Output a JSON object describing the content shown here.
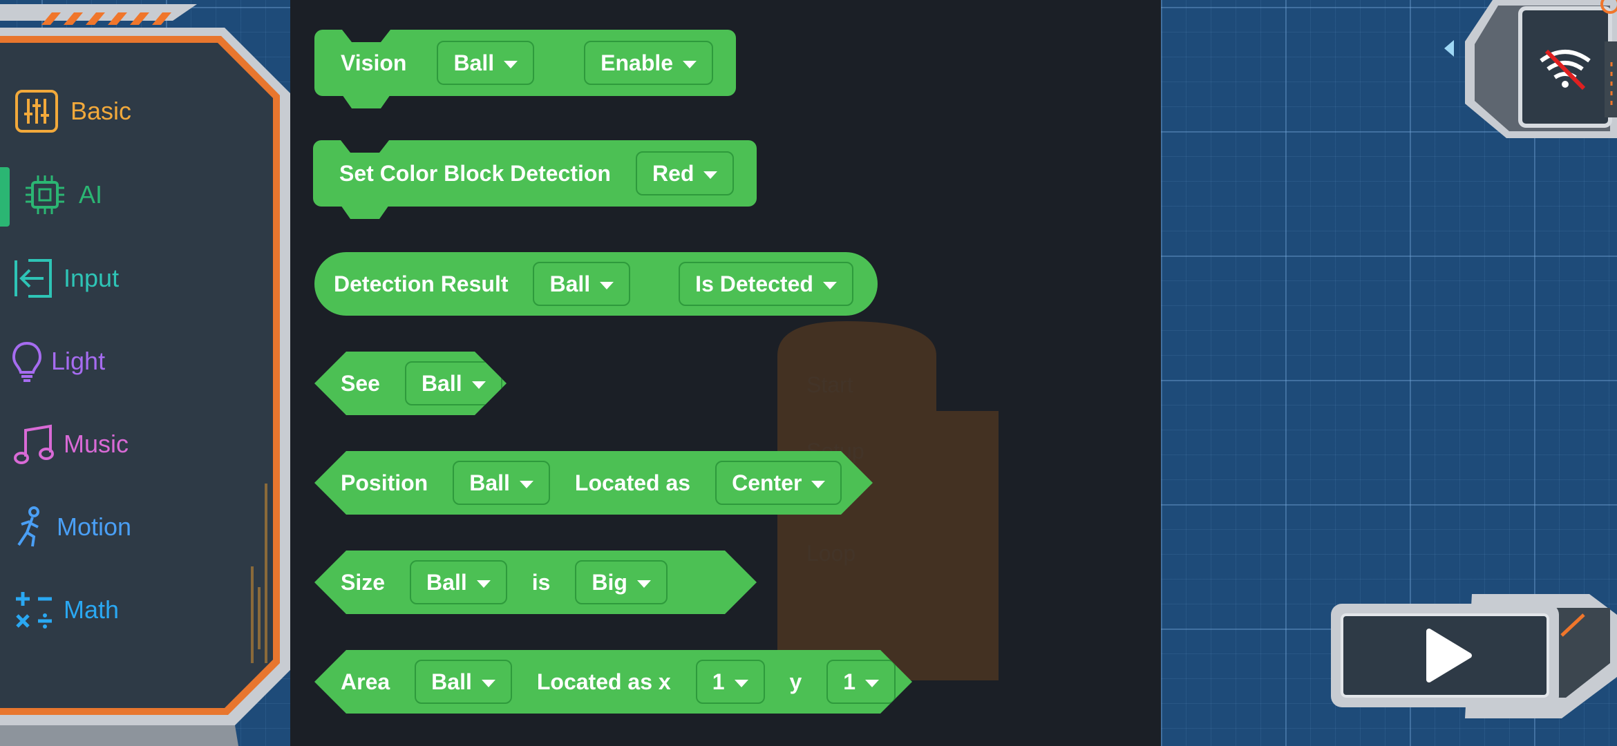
{
  "categories": [
    {
      "label": "Basic",
      "icon": "sliders-icon",
      "color": "#f2a93b"
    },
    {
      "label": "AI",
      "icon": "chip-icon",
      "color": "#2bb673"
    },
    {
      "label": "Input",
      "icon": "input-arrow-icon",
      "color": "#2ec4b6"
    },
    {
      "label": "Light",
      "icon": "lightbulb-icon",
      "color": "#a66cf0"
    },
    {
      "label": "Music",
      "icon": "music-note-icon",
      "color": "#d96ad6"
    },
    {
      "label": "Motion",
      "icon": "running-figure-icon",
      "color": "#4a9ff5"
    },
    {
      "label": "Math",
      "icon": "math-operators-icon",
      "color": "#2aa8f2"
    }
  ],
  "selected_category": "AI",
  "blocks": {
    "vision": {
      "label": "Vision",
      "target": "Ball",
      "mode": "Enable"
    },
    "set_color": {
      "label": "Set Color Block Detection",
      "color": "Red"
    },
    "detection_result": {
      "label": "Detection Result",
      "target": "Ball",
      "state": "Is Detected"
    },
    "see": {
      "label": "See",
      "target": "Ball"
    },
    "position": {
      "label": "Position",
      "target": "Ball",
      "located_as": "Located as",
      "value": "Center"
    },
    "size": {
      "label": "Size",
      "target": "Ball",
      "is": "is",
      "value": "Big"
    },
    "area": {
      "label": "Area",
      "target": "Ball",
      "located_x": "Located as x",
      "x": "1",
      "y_label": "y",
      "y": "1"
    }
  },
  "ghost": {
    "start": "Start",
    "setup": "Setup",
    "loop": "Loop"
  },
  "colors": {
    "block": "#4cc054",
    "flyout": "#1b1f26",
    "workspace": "#1e4b79",
    "accent": "#f0762b"
  }
}
